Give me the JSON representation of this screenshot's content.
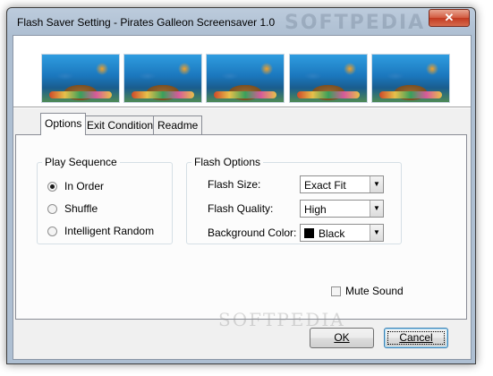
{
  "window": {
    "title": "Flash Saver Setting - Pirates Galleon Screensaver 1.0",
    "watermark": "SOFTPEDIA",
    "close_symbol": "✕"
  },
  "banner": {
    "images": [
      "pirate-galleon-thumbnail"
    ]
  },
  "tabs": [
    {
      "label": "Options",
      "active": true
    },
    {
      "label": "Exit Conditions",
      "active": false
    },
    {
      "label": "Readme",
      "active": false
    }
  ],
  "play_sequence": {
    "legend": "Play Sequence",
    "options": [
      {
        "label": "In Order",
        "checked": true
      },
      {
        "label": "Shuffle",
        "checked": false
      },
      {
        "label": "Intelligent Random",
        "checked": false
      }
    ]
  },
  "flash_options": {
    "legend": "Flash Options",
    "size": {
      "label": "Flash Size:",
      "value": "Exact Fit"
    },
    "quality": {
      "label": "Flash Quality:",
      "value": "High"
    },
    "background": {
      "label": "Background Color:",
      "value": "Black",
      "color": "#000000"
    }
  },
  "mute": {
    "label": "Mute Sound",
    "checked": false
  },
  "buttons": {
    "ok": "OK",
    "cancel": "Cancel"
  },
  "watermark_center": "SOFTPEDIA"
}
